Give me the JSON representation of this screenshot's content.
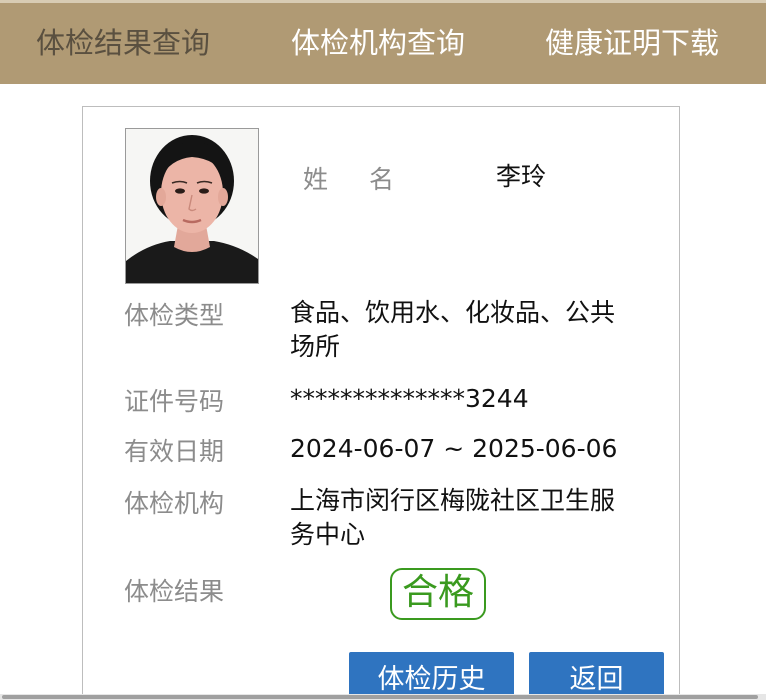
{
  "nav": {
    "tabs": [
      {
        "label": "体检结果查询",
        "active": true
      },
      {
        "label": "体检机构查询",
        "active": false
      },
      {
        "label": "健康证明下载",
        "active": false
      }
    ],
    "bar_color": "#b09a74"
  },
  "person": {
    "name_label_a": "姓",
    "name_label_b": "名",
    "name": "李玲"
  },
  "fields": {
    "type_label": "体检类型",
    "type_value": "食品、饮用水、化妆品、公共场所",
    "id_label": "证件号码",
    "id_value": "**************3244",
    "valid_label": "有效日期",
    "valid_value": "2024-06-07 ~ 2025-06-06",
    "org_label": "体检机构",
    "org_value": "上海市闵行区梅陇社区卫生服务中心",
    "result_label": "体检结果",
    "result_value": "合格"
  },
  "buttons": {
    "history": "体检历史",
    "back": "返回"
  },
  "colors": {
    "accent_blue": "#2f74c0",
    "pass_green": "#3a9a1f"
  }
}
